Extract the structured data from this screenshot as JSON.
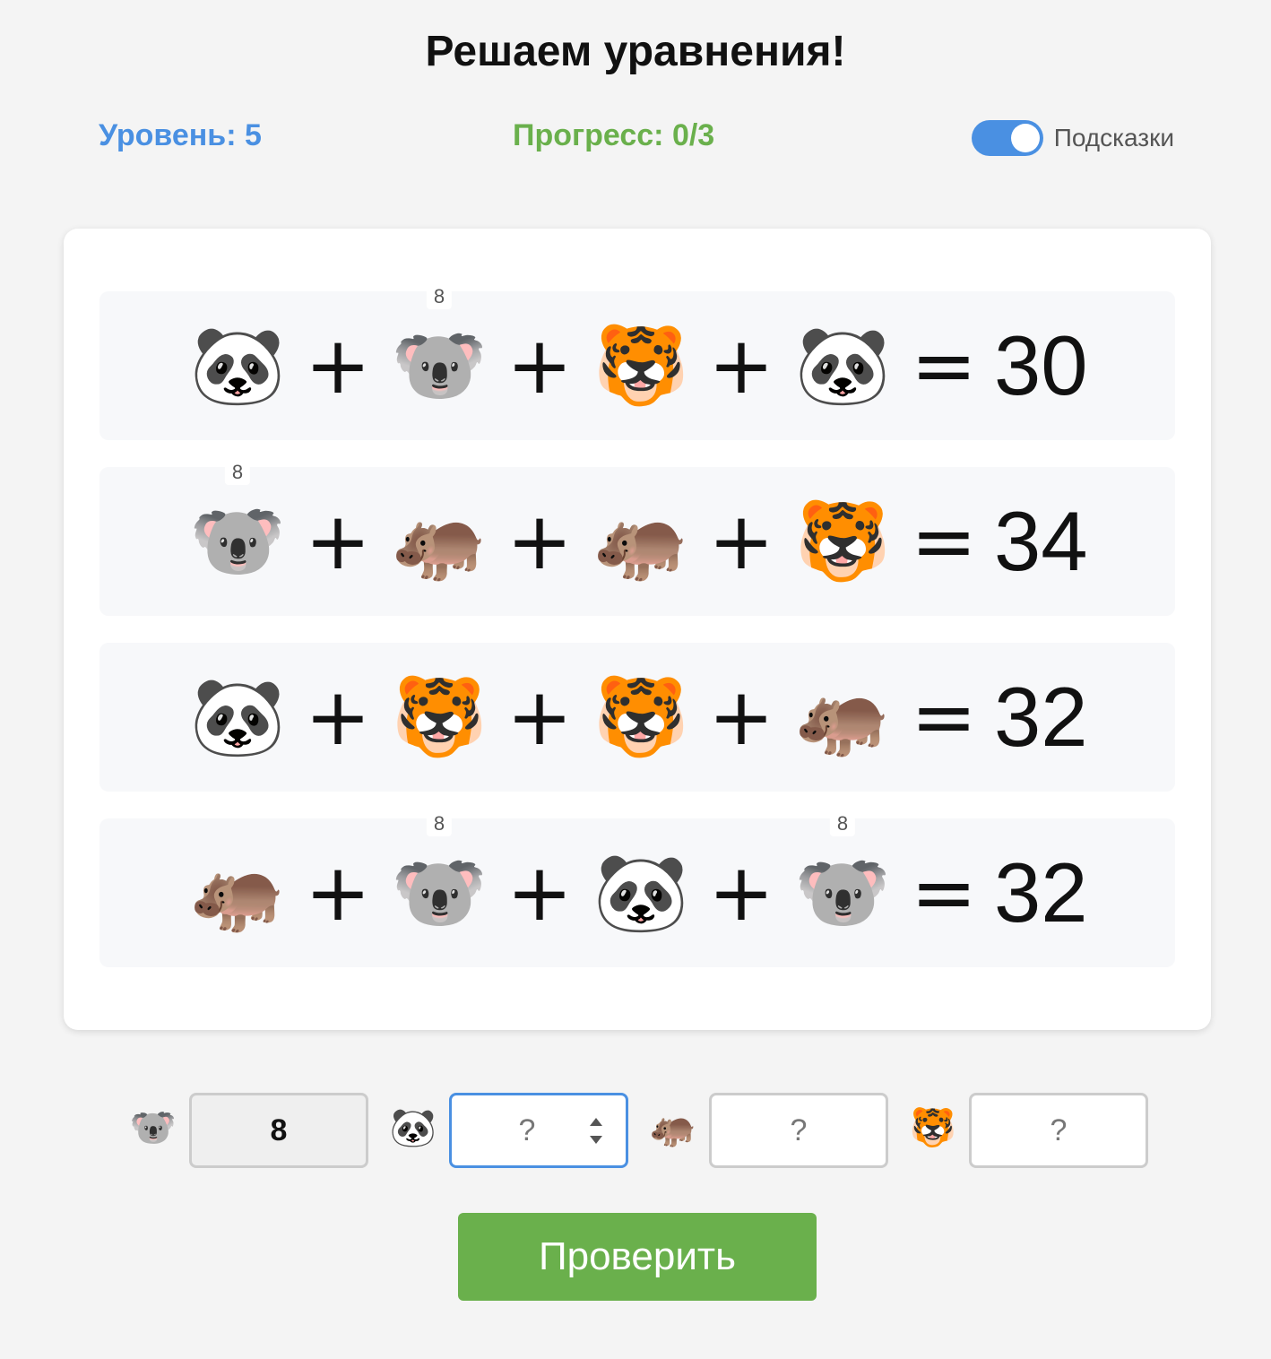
{
  "title": "Решаем уравнения!",
  "status": {
    "level": "Уровень: 5",
    "progress": "Прогресс: 0/3",
    "hints_label": "Подсказки",
    "hints_enabled": true
  },
  "colors": {
    "level": "#4a90e2",
    "progress": "#6ab04c",
    "toggle": "#4a90e2",
    "button": "#6ab04c"
  },
  "equations": [
    {
      "terms": [
        {
          "animal": "🐼",
          "name": "panda",
          "hint": ""
        },
        {
          "animal": "🐨",
          "name": "koala",
          "hint": "8"
        },
        {
          "animal": "🐯",
          "name": "tiger",
          "hint": ""
        },
        {
          "animal": "🐼",
          "name": "panda",
          "hint": ""
        }
      ],
      "operator": "+",
      "equals": "=",
      "result": "30"
    },
    {
      "terms": [
        {
          "animal": "🐨",
          "name": "koala",
          "hint": "8"
        },
        {
          "animal": "🦛",
          "name": "hippo",
          "hint": ""
        },
        {
          "animal": "🦛",
          "name": "hippo",
          "hint": ""
        },
        {
          "animal": "🐯",
          "name": "tiger",
          "hint": ""
        }
      ],
      "operator": "+",
      "equals": "=",
      "result": "34"
    },
    {
      "terms": [
        {
          "animal": "🐼",
          "name": "panda",
          "hint": ""
        },
        {
          "animal": "🐯",
          "name": "tiger",
          "hint": ""
        },
        {
          "animal": "🐯",
          "name": "tiger",
          "hint": ""
        },
        {
          "animal": "🦛",
          "name": "hippo",
          "hint": ""
        }
      ],
      "operator": "+",
      "equals": "=",
      "result": "32"
    },
    {
      "terms": [
        {
          "animal": "🦛",
          "name": "hippo",
          "hint": ""
        },
        {
          "animal": "🐨",
          "name": "koala",
          "hint": "8"
        },
        {
          "animal": "🐼",
          "name": "panda",
          "hint": ""
        },
        {
          "animal": "🐨",
          "name": "koala",
          "hint": "8"
        }
      ],
      "operator": "+",
      "equals": "=",
      "result": "32"
    }
  ],
  "answers": [
    {
      "animal": "🐨",
      "name": "koala",
      "value": "8",
      "placeholder": "?",
      "state": "filled"
    },
    {
      "animal": "🐼",
      "name": "panda",
      "value": "",
      "placeholder": "?",
      "state": "focused"
    },
    {
      "animal": "🦛",
      "name": "hippo",
      "value": "",
      "placeholder": "?",
      "state": "empty"
    },
    {
      "animal": "🐯",
      "name": "tiger",
      "value": "",
      "placeholder": "?",
      "state": "empty"
    }
  ],
  "check_button": "Проверить"
}
